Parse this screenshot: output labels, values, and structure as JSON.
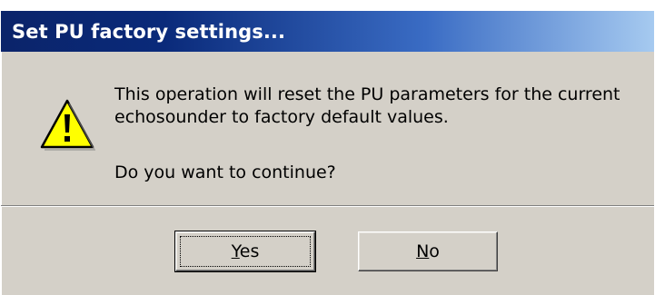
{
  "window": {
    "title": "Set PU factory settings..."
  },
  "icon": {
    "name": "warning-icon",
    "color": "#ffff00"
  },
  "message": {
    "line1": "This operation will reset the PU parameters for the current",
    "line2": "echosounder to factory default values.",
    "question": "Do you want to continue?"
  },
  "buttons": {
    "yes": {
      "mnemonic": "Y",
      "rest": "es"
    },
    "no": {
      "mnemonic": "N",
      "rest": "o"
    }
  },
  "colors": {
    "dialog_bg": "#d4d0c8",
    "title_start": "#0b246a",
    "title_end": "#a6caf0"
  }
}
